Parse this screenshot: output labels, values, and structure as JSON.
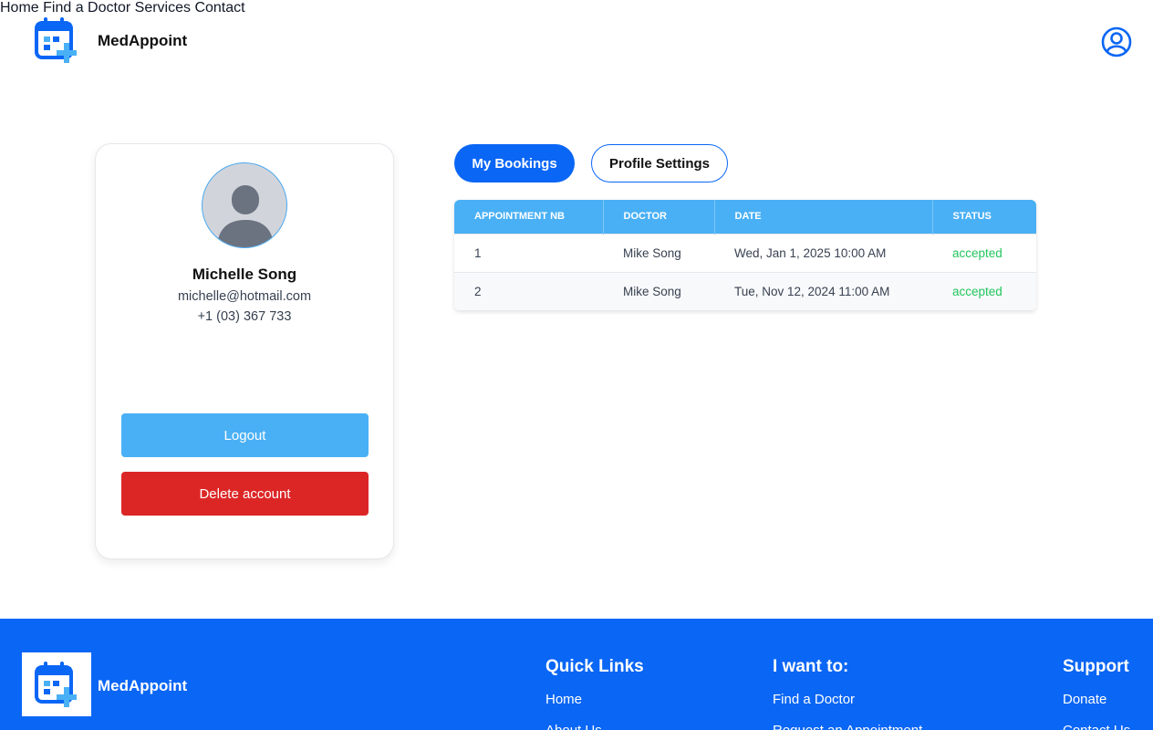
{
  "header": {
    "brand": "MedAppoint",
    "nav": [
      "Home",
      "Find a Doctor",
      "Services",
      "Contact"
    ]
  },
  "profile": {
    "name": "Michelle Song",
    "email": "michelle@hotmail.com",
    "phone": "+1 (03) 367 733",
    "logout_label": "Logout",
    "delete_label": "Delete account"
  },
  "tabs": {
    "bookings": "My Bookings",
    "settings": "Profile Settings"
  },
  "table": {
    "headers": [
      "APPOINTMENT NB",
      "DOCTOR",
      "DATE",
      "STATUS"
    ],
    "rows": [
      {
        "nb": "1",
        "doctor": "Mike Song",
        "date": "Wed, Jan 1, 2025 10:00 AM",
        "status": "accepted"
      },
      {
        "nb": "2",
        "doctor": "Mike Song",
        "date": "Tue, Nov 12, 2024 11:00 AM",
        "status": "accepted"
      }
    ]
  },
  "footer": {
    "brand": "MedAppoint",
    "quick_links": {
      "title": "Quick Links",
      "items": [
        "Home",
        "About Us"
      ]
    },
    "i_want_to": {
      "title": "I want to:",
      "items": [
        "Find a Doctor",
        "Request an Appointment"
      ]
    },
    "support": {
      "title": "Support",
      "items": [
        "Donate",
        "Contact Us"
      ]
    }
  },
  "colors": {
    "primary": "#0a66f5",
    "accent": "#4ab0f5",
    "danger": "#dc2626",
    "success": "#22c55e"
  },
  "icons": [
    "calendar-plus-icon",
    "user-circle-icon"
  ]
}
